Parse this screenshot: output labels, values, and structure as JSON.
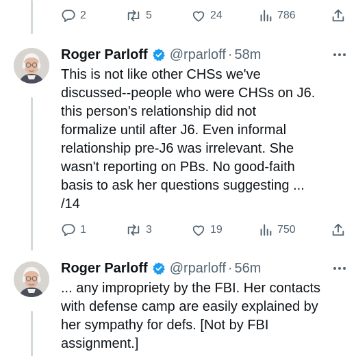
{
  "top_actions": {
    "reply_count": "2",
    "repost_count": "5",
    "like_count": "24",
    "view_count": "786"
  },
  "tweets": [
    {
      "author": "Roger Parloff",
      "handle": "@rparloff",
      "separator": "·",
      "time": "58m",
      "text": "This is not like other CHSs we've\ndiscussed--people who were CHSs on J6.\nthis person's relationship did not\nformalize until after J6. Even informal\nrelationship pre-J6 was irrelevant. She\nwasn't reporting on PBs. No good-faith\nbasis to ask her questions suggesting ...\n/14",
      "reply_count": "1",
      "repost_count": "3",
      "like_count": "19",
      "view_count": "750"
    },
    {
      "author": "Roger Parloff",
      "handle": "@rparloff",
      "separator": "·",
      "time": "56m",
      "text": "... any impropriety by the FBI. Her contacts\nwith defense camp are easily explained by\nher sympathy for defs. [Not by FBI\nassignment.]"
    }
  ],
  "colors": {
    "text_primary": "#0f1419",
    "text_secondary": "#536471",
    "verified_blue": "#1d9bf0",
    "thread_line": "#cfd9de"
  },
  "icons": {
    "reply": "speech-bubble-icon",
    "repost": "repost-arrows-icon",
    "like": "heart-icon",
    "views": "bar-chart-icon",
    "share": "share-upload-icon",
    "verified": "verified-badge-icon",
    "more": "more-dots-icon"
  }
}
